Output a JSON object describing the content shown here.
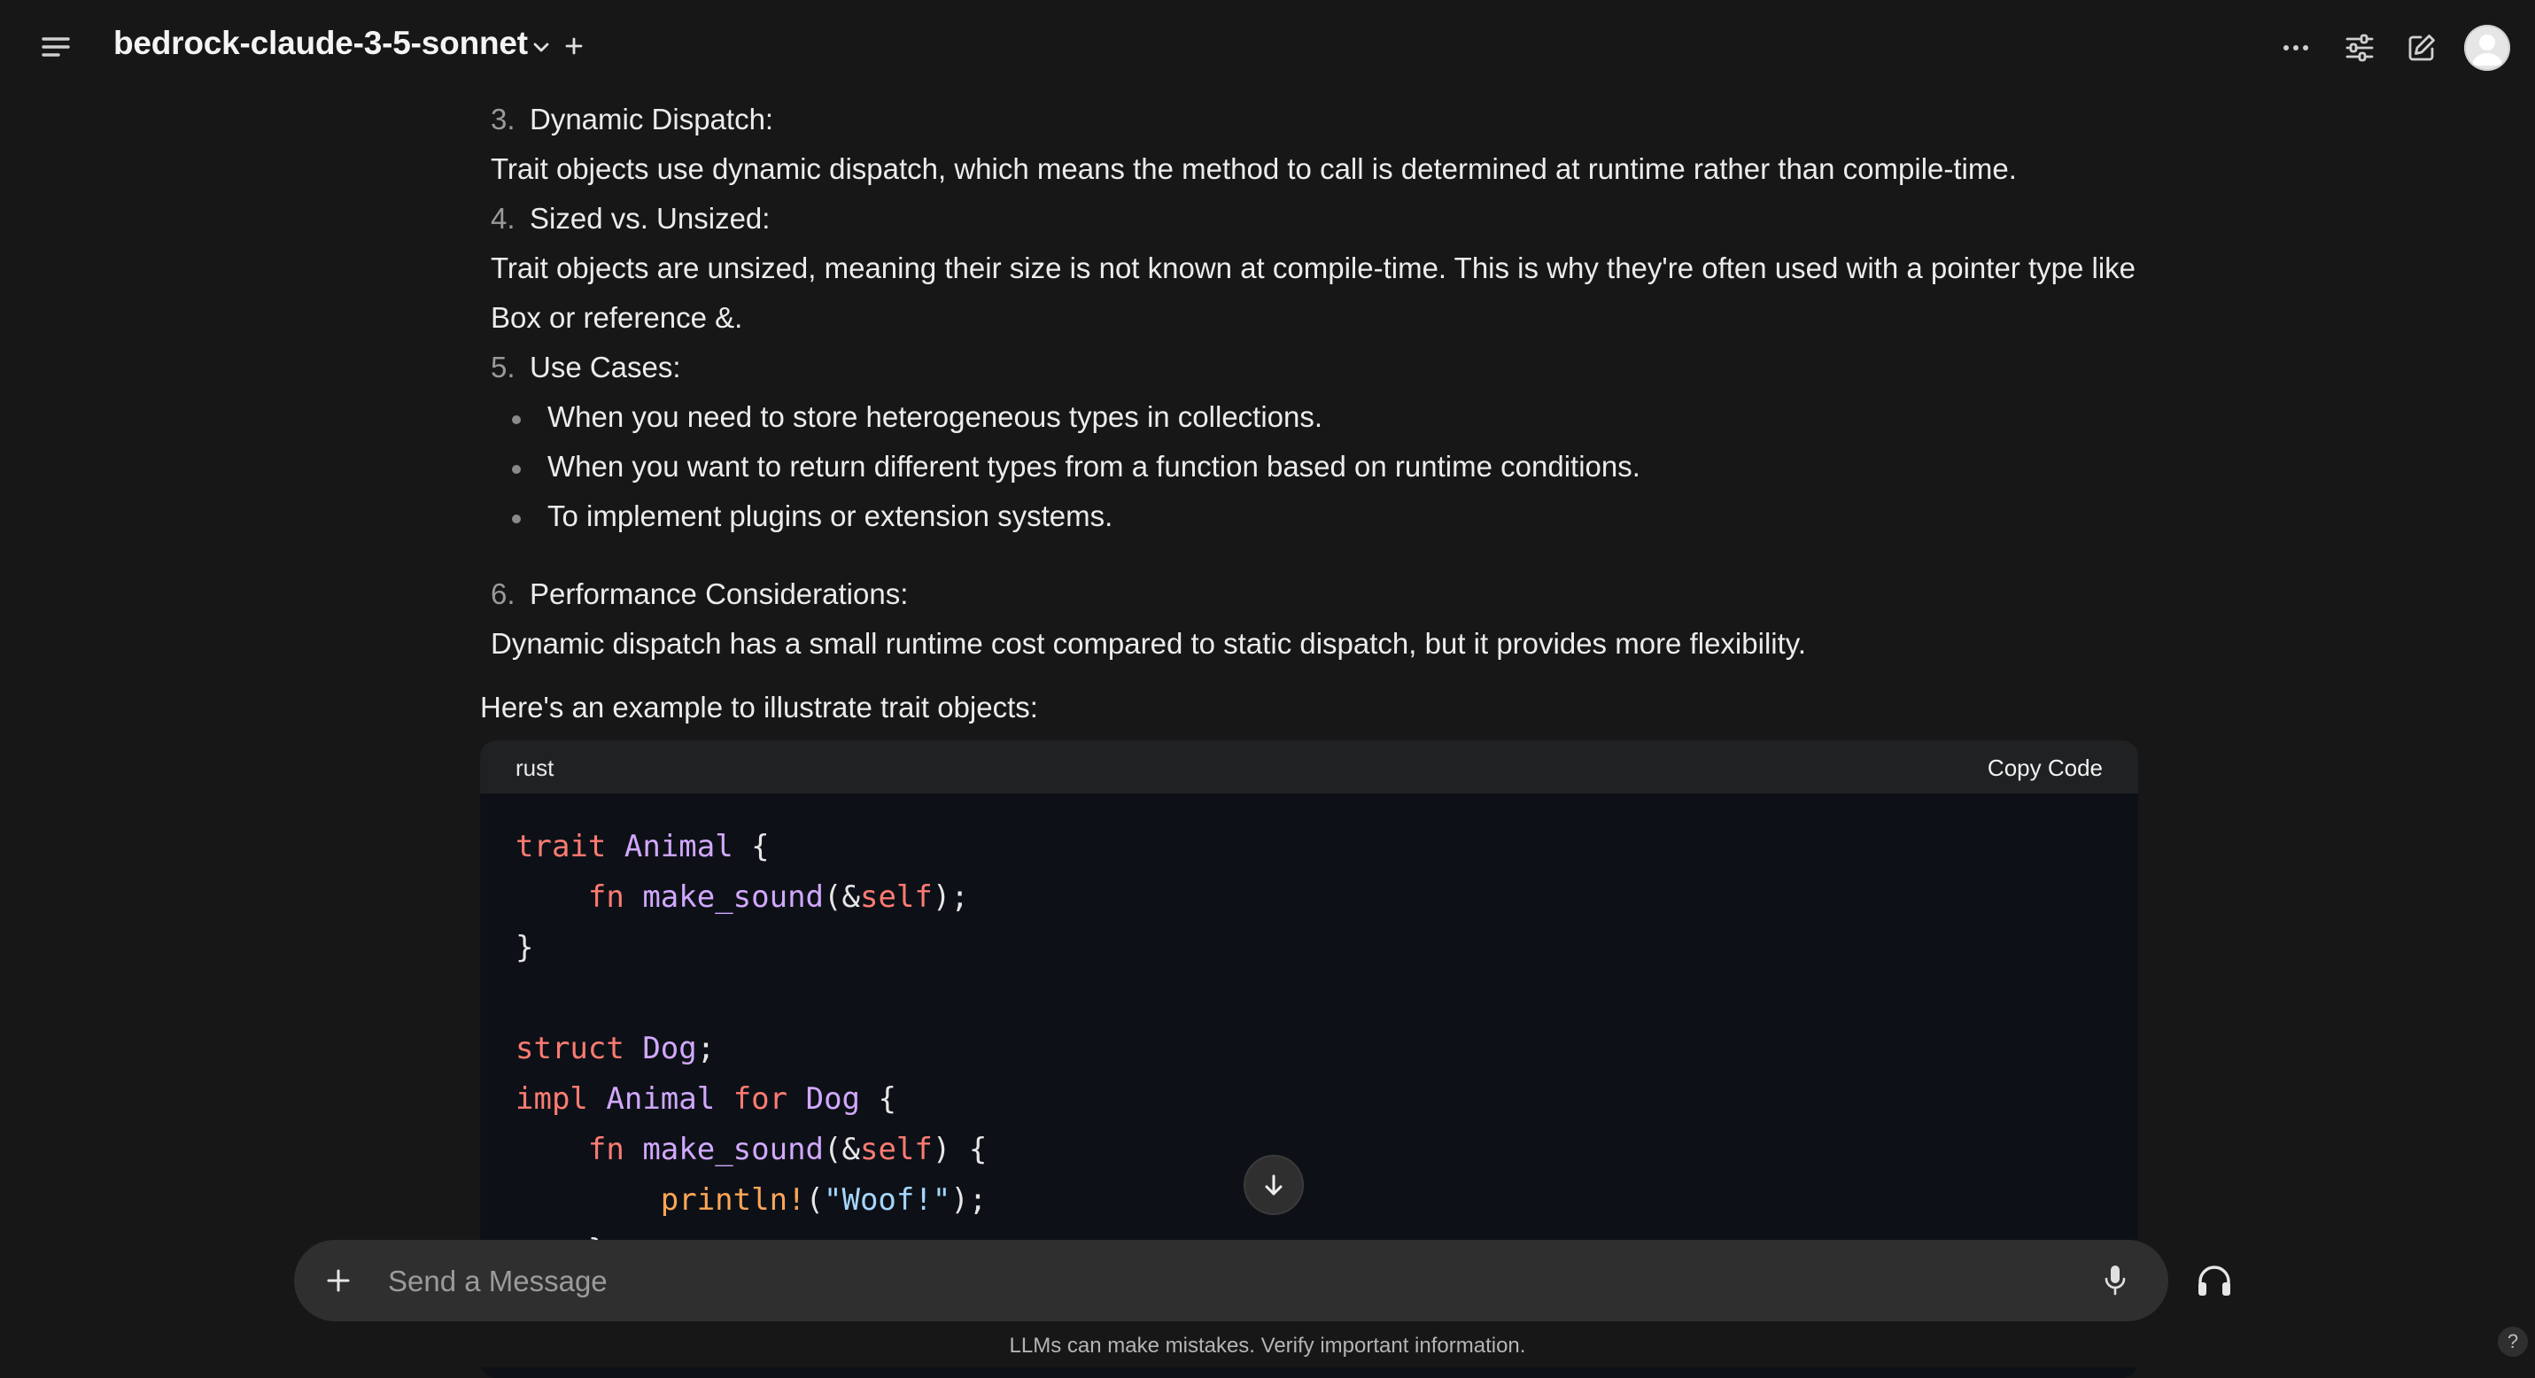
{
  "header": {
    "model_name": "bedrock-claude-3-5-sonnet",
    "icons": [
      "menu-icon",
      "chevron-down-icon",
      "plus-icon",
      "more-horizontal-icon",
      "sliders-icon",
      "edit-icon",
      "user-avatar-icon"
    ]
  },
  "message": {
    "items": [
      {
        "num": "3.",
        "title": "Dynamic Dispatch:"
      },
      {
        "text": "Trait objects use dynamic dispatch, which means the method to call is determined at runtime rather than compile-time."
      },
      {
        "num": "4.",
        "title": "Sized vs. Unsized:"
      },
      {
        "text_line1": "Trait objects are unsized, meaning their size is not known at compile-time. This is why they're often used with a pointer type like",
        "text_line2": "Box or reference &."
      },
      {
        "num": "5.",
        "title": "Use Cases:"
      },
      {
        "bullets": [
          "When you need to store heterogeneous types in collections.",
          "When you want to return different types from a function based on runtime conditions.",
          "To implement plugins or extension systems."
        ]
      },
      {
        "num": "6.",
        "title": "Performance Considerations:"
      },
      {
        "text": "Dynamic dispatch has a small runtime cost compared to static dispatch, but it provides more flexibility."
      }
    ],
    "example_intro": "Here's an example to illustrate trait objects:"
  },
  "code": {
    "language": "rust",
    "copy_label": "Copy Code",
    "lines": [
      "trait Animal {",
      "    fn make_sound(&self);",
      "}",
      "",
      "struct Dog;",
      "impl Animal for Dog {",
      "    fn make_sound(&self) {",
      "        println!(\"Woof!\");",
      "    }"
    ]
  },
  "composer": {
    "placeholder": "Send a Message",
    "disclaimer": "LLMs can make mistakes. Verify important information.",
    "help_label": "?"
  }
}
